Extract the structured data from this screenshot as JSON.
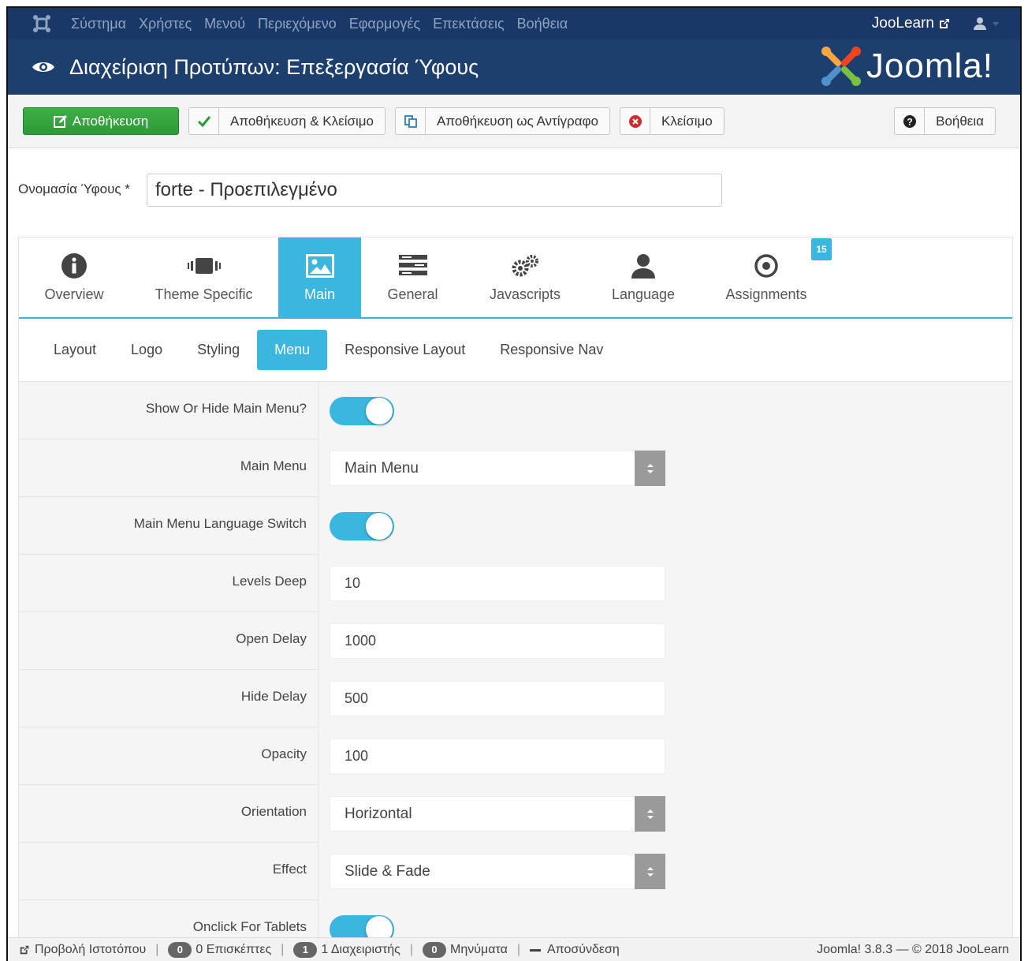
{
  "topnav": {
    "menu": [
      "Σύστημα",
      "Χρήστες",
      "Μενού",
      "Περιεχόμενο",
      "Εφαρμογές",
      "Επεκτάσεις",
      "Βοήθεια"
    ],
    "site_link": "JooLearn"
  },
  "header": {
    "title": "Διαχείριση Προτύπων: Επεξεργασία Ύφους",
    "brand": "Joomla!"
  },
  "toolbar": {
    "save": "Αποθήκευση",
    "save_close": "Αποθήκευση & Κλείσιμο",
    "save_copy": "Αποθήκευση ως Αντίγραφο",
    "close": "Κλείσιμο",
    "help": "Βοήθεια"
  },
  "style_name": {
    "label": "Ονομασία Ύφους *",
    "value": "forte - Προεπιλεγμένο"
  },
  "tabs": [
    "Overview",
    "Theme Specific",
    "Main",
    "General",
    "Javascripts",
    "Language",
    "Assignments"
  ],
  "assignments_badge": "15",
  "subtabs": [
    "Layout",
    "Logo",
    "Styling",
    "Menu",
    "Responsive Layout",
    "Responsive Nav"
  ],
  "fields": {
    "show_hide": {
      "label": "Show Or Hide Main Menu?",
      "on": true
    },
    "main_menu": {
      "label": "Main Menu",
      "value": "Main Menu"
    },
    "lang_switch": {
      "label": "Main Menu Language Switch",
      "on": true
    },
    "levels": {
      "label": "Levels Deep",
      "value": "10"
    },
    "open_delay": {
      "label": "Open Delay",
      "value": "1000"
    },
    "hide_delay": {
      "label": "Hide Delay",
      "value": "500"
    },
    "opacity": {
      "label": "Opacity",
      "value": "100"
    },
    "orientation": {
      "label": "Orientation",
      "value": "Horizontal"
    },
    "effect": {
      "label": "Effect",
      "value": "Slide & Fade"
    },
    "onclick_tablets": {
      "label": "Onclick For Tablets",
      "on": true
    }
  },
  "statusbar": {
    "view_site": "Προβολή Ιστοτόπου",
    "visitors_count": "0",
    "visitors": "0 Επισκέπτες",
    "admins_count": "1",
    "admins": "1 Διαχειριστής",
    "messages_count": "0",
    "messages": "Μηνύματα",
    "logout": "Αποσύνδεση",
    "version": "Joomla! 3.8.3 — © 2018 JooLearn"
  },
  "colors": {
    "accent": "#3ab6df",
    "navbar": "#1a3867",
    "header": "#1d3f6e",
    "save": "#2d9a38"
  }
}
